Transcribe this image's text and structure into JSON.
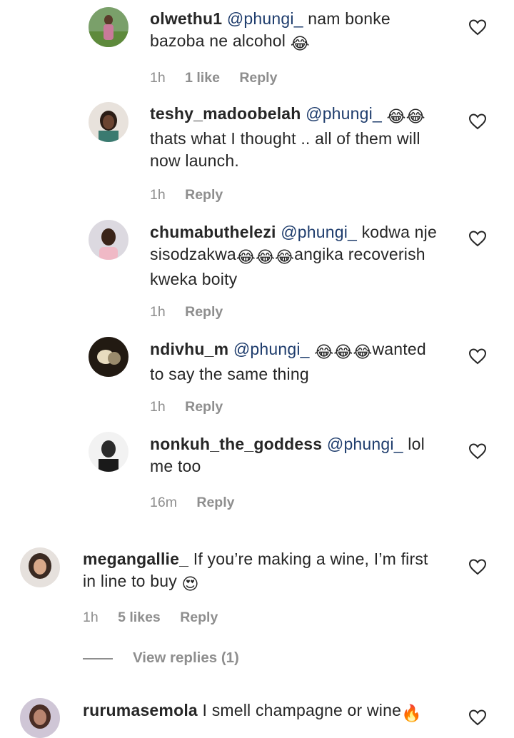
{
  "comments": [
    {
      "username": "olwethu1",
      "mention": "@phungi_",
      "text_line1": "nam bonke",
      "text_line2": "bazoba ne alcohol",
      "emoji": "😂",
      "time": "1h",
      "likes": "1 like",
      "reply": "Reply"
    },
    {
      "username": "teshy_madoobelah",
      "mention": "@phungi_",
      "emoji": "😂😂",
      "text_line2": "thats what I thought .. all of them will",
      "text_line3": "now launch.",
      "time": "1h",
      "reply": "Reply"
    },
    {
      "username": "chumabuthelezi",
      "mention": "@phungi_",
      "text_line1": "kodwa nje",
      "text_line2a": "sisodzakwa",
      "emoji": "😂😂😂",
      "text_line2b": "angika recoverish",
      "text_line3": "kweka boity",
      "time": "1h",
      "reply": "Reply"
    },
    {
      "username": "ndivhu_m",
      "mention": "@phungi_",
      "emoji": "😂😂😂",
      "text_line1": "wanted",
      "text_line2": "to say the same thing",
      "time": "1h",
      "reply": "Reply"
    },
    {
      "username": "nonkuh_the_goddess",
      "mention": "@phungi_",
      "text_line1": "lol",
      "text_line2": "me too",
      "time": "16m",
      "reply": "Reply"
    },
    {
      "username": "megangallie_",
      "text_line1": "If you’re making a wine, I’m first",
      "text_line2": "in line to buy",
      "emoji": "😍",
      "time": "1h",
      "likes": "5 likes",
      "reply": "Reply"
    },
    {
      "username": "rurumasemola",
      "text_line1": "I smell champagne or wine",
      "emoji": "🔥"
    }
  ],
  "view_replies": "View replies (1)",
  "icons": {
    "like": "heart-outline-icon"
  },
  "colors": {
    "text": "#262626",
    "mention": "#1f3d6d",
    "meta": "#8e8e8e"
  }
}
